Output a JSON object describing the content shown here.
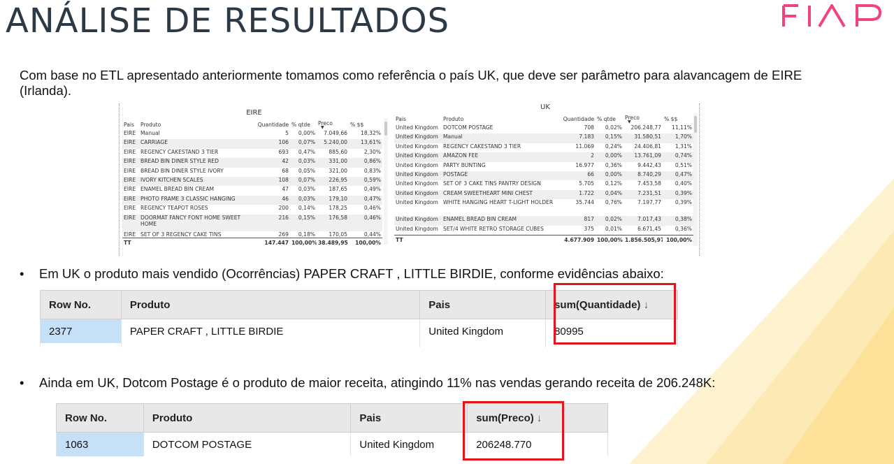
{
  "slide": {
    "title": "ANÁLISE DE RESULTADOS",
    "logo_text": "FIAP",
    "intro": "Com base no ETL apresentado anteriormente tomamos como referência o país UK, que deve ser parâmetro para alavancagem de EIRE (Irlanda)."
  },
  "eire": {
    "title": "EIRE",
    "headers": [
      "Pais",
      "Produto",
      "Quantidade",
      "% qtde",
      "Preco",
      "% $$"
    ],
    "rows": [
      [
        "EIRE",
        "Manual",
        "5",
        "0,00%",
        "7.049,66",
        "18,32%"
      ],
      [
        "EIRE",
        "CARRIAGE",
        "106",
        "0,07%",
        "5.240,00",
        "13,61%"
      ],
      [
        "EIRE",
        "REGENCY CAKESTAND 3 TIER",
        "693",
        "0,47%",
        "885,60",
        "2,30%"
      ],
      [
        "EIRE",
        "BREAD BIN DINER STYLE RED",
        "42",
        "0,03%",
        "331,00",
        "0,86%"
      ],
      [
        "EIRE",
        "BREAD BIN DINER STYLE IVORY",
        "68",
        "0,05%",
        "321,00",
        "0,83%"
      ],
      [
        "EIRE",
        "IVORY KITCHEN SCALES",
        "108",
        "0,07%",
        "226,95",
        "0,59%"
      ],
      [
        "EIRE",
        "ENAMEL BREAD BIN CREAM",
        "47",
        "0,03%",
        "187,65",
        "0,49%"
      ],
      [
        "EIRE",
        "PHOTO FRAME 3 CLASSIC HANGING",
        "46",
        "0,03%",
        "179,10",
        "0,47%"
      ],
      [
        "EIRE",
        "REGENCY TEAPOT ROSES",
        "200",
        "0,14%",
        "178,25",
        "0,46%"
      ],
      [
        "EIRE",
        "DOORMAT FANCY FONT HOME SWEET HOME",
        "216",
        "0,15%",
        "176,58",
        "0,46%"
      ],
      [
        "EIRE",
        "SET OF 3 REGENCY CAKE TINS",
        "269",
        "0,18%",
        "170,05",
        "0,44%"
      ]
    ],
    "total": [
      "TT",
      "",
      "147.447",
      "100,00%",
      "38.489,95",
      "100,00%"
    ]
  },
  "uk": {
    "title": "UK",
    "headers": [
      "Pais",
      "Produto",
      "Quantidade",
      "% qtde",
      "Preco",
      "% $$"
    ],
    "rows": [
      [
        "United Kingdom",
        "DOTCOM POSTAGE",
        "708",
        "0,02%",
        "206.248,77",
        "11,11%"
      ],
      [
        "United Kingdom",
        "Manual",
        "7.183",
        "0,15%",
        "31.580,51",
        "1,70%"
      ],
      [
        "United Kingdom",
        "REGENCY CAKESTAND 3 TIER",
        "11.069",
        "0,24%",
        "24.406,81",
        "1,31%"
      ],
      [
        "United Kingdom",
        "AMAZON FEE",
        "2",
        "0,00%",
        "13.761,09",
        "0,74%"
      ],
      [
        "United Kingdom",
        "PARTY BUNTING",
        "16.977",
        "0,36%",
        "9.442,43",
        "0,51%"
      ],
      [
        "United Kingdom",
        "POSTAGE",
        "66",
        "0,00%",
        "8.740,29",
        "0,47%"
      ],
      [
        "United Kingdom",
        "SET OF 3 CAKE TINS PANTRY DESIGN",
        "5.705",
        "0,12%",
        "7.453,58",
        "0,40%"
      ],
      [
        "United Kingdom",
        "CREAM SWEETHEART MINI CHEST",
        "1.722",
        "0,04%",
        "7.231,51",
        "0,39%"
      ],
      [
        "United Kingdom",
        "WHITE HANGING HEART T-LIGHT HOLDER",
        "35.744",
        "0,76%",
        "7.197,77",
        "0,39%"
      ],
      [
        "United Kingdom",
        "ENAMEL BREAD BIN CREAM",
        "817",
        "0,02%",
        "7.017,43",
        "0,38%"
      ],
      [
        "United Kingdom",
        "SET/4 WHITE RETRO STORAGE CUBES",
        "375",
        "0,01%",
        "6.671,45",
        "0,36%"
      ]
    ],
    "total": [
      "TT",
      "",
      "4.677.909",
      "100,00%",
      "1.856.505,97",
      "100,00%"
    ]
  },
  "bullet1": {
    "marker": "•",
    "text": "Em UK o produto mais vendido (Ocorrências) PAPER CRAFT , LITTLE BIRDIE, conforme evidências abaixo:"
  },
  "grid1": {
    "headers": [
      "Row No.",
      "Produto",
      "Pais",
      "sum(Quantidade)"
    ],
    "sort_icon": "↓",
    "row": [
      "2377",
      "PAPER CRAFT , LITTLE BIRDIE",
      "United Kingdom",
      "80995"
    ]
  },
  "bullet2": {
    "marker": "•",
    "text": "Ainda em UK, Dotcom Postage é o produto de maior receita, atingindo 11% nas vendas gerando receita de 206.248K:"
  },
  "grid2": {
    "headers": [
      "Row No.",
      "Produto",
      "Pais",
      "sum(Preco)"
    ],
    "sort_icon": "↓",
    "row": [
      "1063",
      "DOTCOM POSTAGE",
      "United Kingdom",
      "206248.770"
    ]
  },
  "colors": {
    "title": "#2c3a47",
    "logo": "#f0447a",
    "highlight_box": "#e3141b",
    "row_no_cell": "#c6e0f7",
    "decoration": "#fde9b3"
  }
}
